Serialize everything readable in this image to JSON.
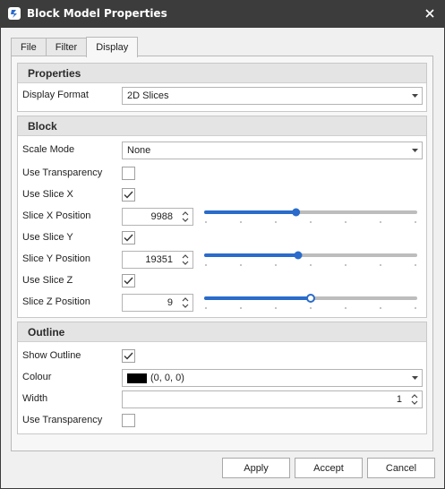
{
  "window": {
    "title": "Block Model Properties",
    "app_icon": "app-logo-icon",
    "close_icon": "close-icon",
    "title_bar_color": "#3c3c3c",
    "accent_color": "#2a6bcb"
  },
  "tabs": [
    {
      "label": "File",
      "active": false
    },
    {
      "label": "Filter",
      "active": false
    },
    {
      "label": "Display",
      "active": true
    }
  ],
  "properties": {
    "header": "Properties",
    "display_format": {
      "label": "Display Format",
      "value": "2D Slices"
    }
  },
  "block": {
    "header": "Block",
    "scale_mode": {
      "label": "Scale Mode",
      "value": "None"
    },
    "use_transparency": {
      "label": "Use Transparency",
      "checked": false
    },
    "use_slice_x": {
      "label": "Use Slice X",
      "checked": true
    },
    "slice_x_position": {
      "label": "Slice X Position",
      "value": "9988",
      "slider_fraction": 0.43
    },
    "use_slice_y": {
      "label": "Use Slice Y",
      "checked": true
    },
    "slice_y_position": {
      "label": "Slice Y Position",
      "value": "19351",
      "slider_fraction": 0.44
    },
    "use_slice_z": {
      "label": "Use Slice Z",
      "checked": true
    },
    "slice_z_position": {
      "label": "Slice Z Position",
      "value": "9",
      "slider_fraction": 0.5
    }
  },
  "outline": {
    "header": "Outline",
    "show_outline": {
      "label": "Show Outline",
      "checked": true
    },
    "colour": {
      "label": "Colour",
      "value": "(0, 0, 0)",
      "swatch": "#000000"
    },
    "width": {
      "label": "Width",
      "value": "1"
    },
    "use_transparency": {
      "label": "Use Transparency",
      "checked": false
    }
  },
  "buttons": {
    "apply": "Apply",
    "accept": "Accept",
    "cancel": "Cancel"
  }
}
